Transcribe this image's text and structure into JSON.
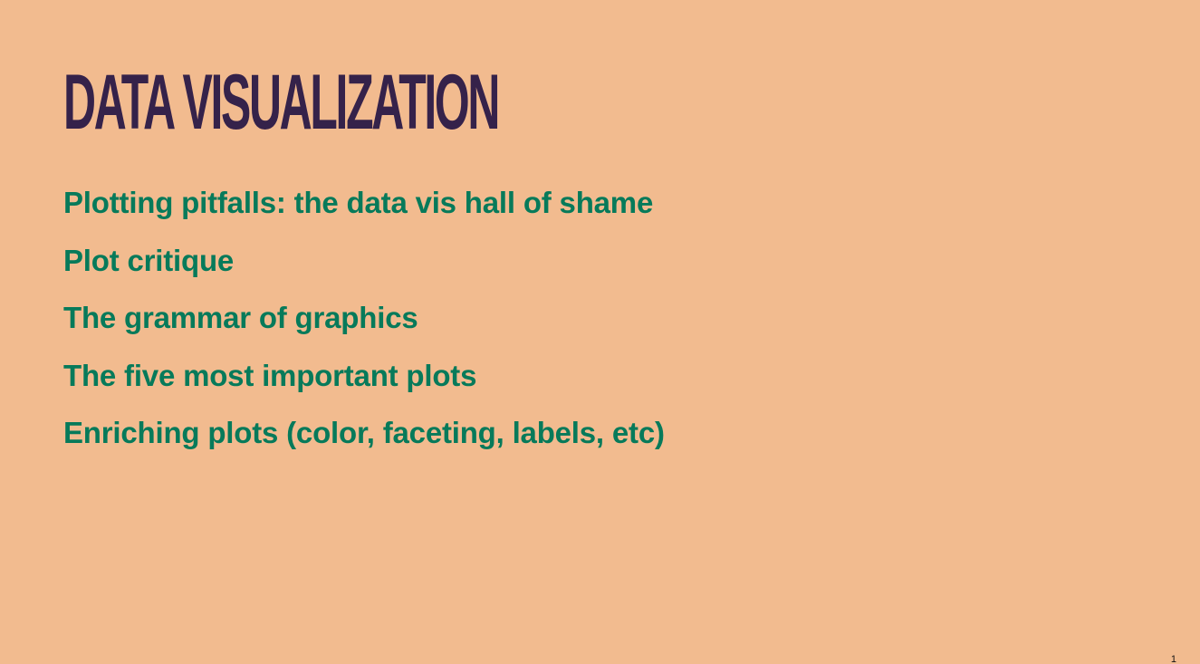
{
  "slide": {
    "title": "DATA VISUALIZATION",
    "topics": [
      "Plotting pitfalls: the data vis hall of shame",
      "Plot critique",
      "The grammar of graphics",
      "The five most important plots",
      "Enriching plots (color, faceting, labels, etc)"
    ],
    "page_number": "1"
  },
  "colors": {
    "background": "#f2bb8f",
    "title": "#35224a",
    "topic_text": "#077a5a"
  }
}
